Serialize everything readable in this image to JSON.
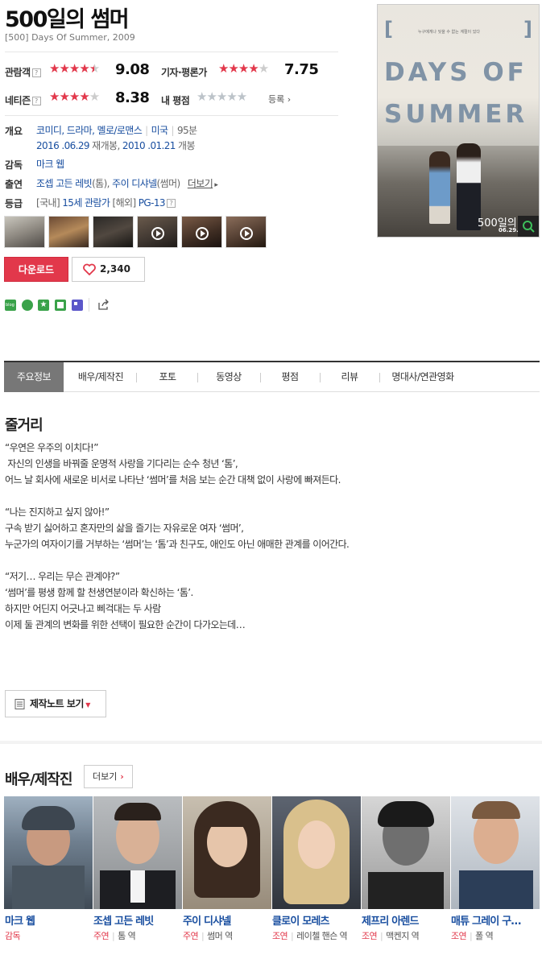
{
  "movie": {
    "title": "500일의 썸머",
    "subtitle": "[500] Days Of Summer, 2009",
    "ratings": {
      "audience_label": "관람객",
      "audience_score": "9.08",
      "audience_stars": 4.5,
      "critic_label": "기자·평론가",
      "critic_score": "7.75",
      "critic_stars": 4,
      "netizen_label": "네티즌",
      "netizen_score": "8.38",
      "netizen_stars": 4,
      "my_label": "내 평점",
      "my_register": "등록"
    },
    "overview_label": "개요",
    "genres": "코미디, 드라마, 멜로/로맨스",
    "country": "미국",
    "runtime": "95분",
    "release_date1": "2016 .06.29",
    "release_text1": "재개봉,",
    "release_date2": "2010 .01.21",
    "release_text2": "개봉",
    "director_label": "감독",
    "director": "마크 웹",
    "cast_label": "출연",
    "cast_text1": "조셉 고든 레빗",
    "cast_role1": "(톰),",
    "cast_text2": "주이 디샤넬",
    "cast_role2": "(썸머)",
    "cast_more": "더보기",
    "grade_label": "등급",
    "grade_domestic_tag": "[국내]",
    "grade_domestic": "15세 관람가",
    "grade_foreign_tag": "[해외]",
    "grade_foreign": "PG-13"
  },
  "buttons": {
    "download": "다운로드",
    "likes": "2,340",
    "note": "제작노트 보기"
  },
  "poster": {
    "line1": "DAYS OF",
    "line2": "SUMMER",
    "bracket_left": "[",
    "bracket_right": "]",
    "tagline": "누구에게나 잊을 수 없는 계절이 있다",
    "title_kor": "500일의",
    "date": "06.29."
  },
  "tabs": [
    "주요정보",
    "배우/제작진",
    "포토",
    "동영상",
    "평점",
    "리뷰",
    "명대사/연관영화"
  ],
  "synopsis": {
    "heading": "줄거리",
    "lines": [
      "“우연은 우주의 이치다!”",
      " 자신의 인생을 바꿔줄 운명적 사랑을 기다리는 순수 청년 ‘톰’,",
      "어느 날 회사에 새로운 비서로 나타난 ‘썸머’를 처음 보는 순간 대책 없이 사랑에 빠져든다.",
      "",
      "“나는 진지하고 싶지 않아!”",
      "구속 받기 싫어하고 혼자만의 삶을 즐기는 자유로운 여자 ‘썸머’,",
      "누군가의 여자이기를 거부하는 ‘썸머’는 ‘톰’과 친구도, 애인도 아닌 애매한 관계를 이어간다.",
      "",
      "“저기… 우리는 무슨 관계야?”",
      "‘썸머’를 평생 함께 할 천생연분이라 확신하는 ‘톰’.",
      "하지만 어딘지 어긋나고 삐걱대는 두 사람",
      "이제 둘 관계의 변화를 위한 선택이 필요한 순간이 다가오는데…"
    ]
  },
  "crew": {
    "heading": "배우/제작진",
    "more": "더보기",
    "people": [
      {
        "name": "마크 웹",
        "role": "감독",
        "character": ""
      },
      {
        "name": "조셉 고든 레빗",
        "role": "주연",
        "character": "톰 역"
      },
      {
        "name": "주이 디샤넬",
        "role": "주연",
        "character": "썸머 역"
      },
      {
        "name": "클로이 모레츠",
        "role": "조연",
        "character": "레이첼 핸슨 역"
      },
      {
        "name": "제프리 아렌드",
        "role": "조연",
        "character": "맥켄지 역"
      },
      {
        "name": "매튜 그레이 구…",
        "role": "조연",
        "character": "폴 역"
      }
    ]
  },
  "colors": {
    "accent": "#e2384b",
    "link": "#1a4fa0",
    "tab_active": "#777777"
  }
}
